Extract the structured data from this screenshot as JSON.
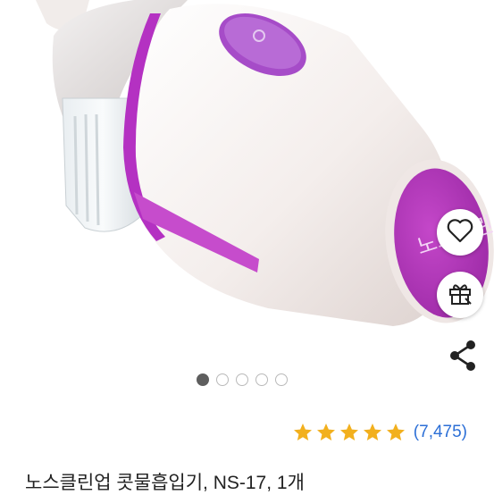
{
  "product": {
    "name": "노스클린업 콧물흡입기, NS-17, 1개",
    "brand_logo": "노스클린",
    "accent_color": "#b431c2",
    "body_color": "#f6f0ee"
  },
  "gallery": {
    "image_count": 5,
    "active_index": 0
  },
  "actions": {
    "wishlist_icon": "heart-icon",
    "gift_icon": "gift-icon",
    "share_icon": "share-icon"
  },
  "rating": {
    "stars": 4.5,
    "max": 5,
    "count_label": "(7,475)",
    "star_color": "#f2b01e"
  }
}
